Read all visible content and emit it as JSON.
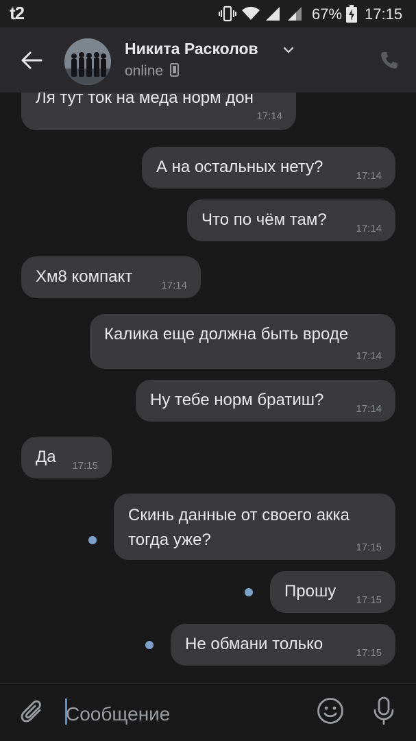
{
  "status_bar": {
    "carrier": "t2",
    "battery": "67%",
    "time": "17:15"
  },
  "header": {
    "contact_name": "Никита Расколов",
    "status": "online"
  },
  "messages": [
    {
      "text": "Ля тут ток на меда норм дон",
      "time": "17:14",
      "outgoing": false
    },
    {
      "text": "А на остальных нету?",
      "time": "17:14",
      "outgoing": true
    },
    {
      "text": "Что по чём там?",
      "time": "17:14",
      "outgoing": true
    },
    {
      "text": "Хм8 компакт",
      "time": "17:14",
      "outgoing": false
    },
    {
      "text": "Калика еще должна быть вроде",
      "time": "17:14",
      "outgoing": true
    },
    {
      "text": "Ну тебе норм братиш?",
      "time": "17:14",
      "outgoing": true
    },
    {
      "text": "Да",
      "time": "17:15",
      "outgoing": false
    },
    {
      "text": "Скинь данные от своего акка тогда уже?",
      "time": "17:15",
      "outgoing": true,
      "unread": true
    },
    {
      "text": "Прошу",
      "time": "17:15",
      "outgoing": true,
      "unread": true
    },
    {
      "text": "Не обмани только",
      "time": "17:15",
      "outgoing": true,
      "unread": true
    }
  ],
  "composer": {
    "placeholder": "Сообщение"
  },
  "colors": {
    "background": "#19191a",
    "bubble": "#3a3a3c",
    "header": "#2a2a2c",
    "unread_dot": "#7ea1cc"
  }
}
